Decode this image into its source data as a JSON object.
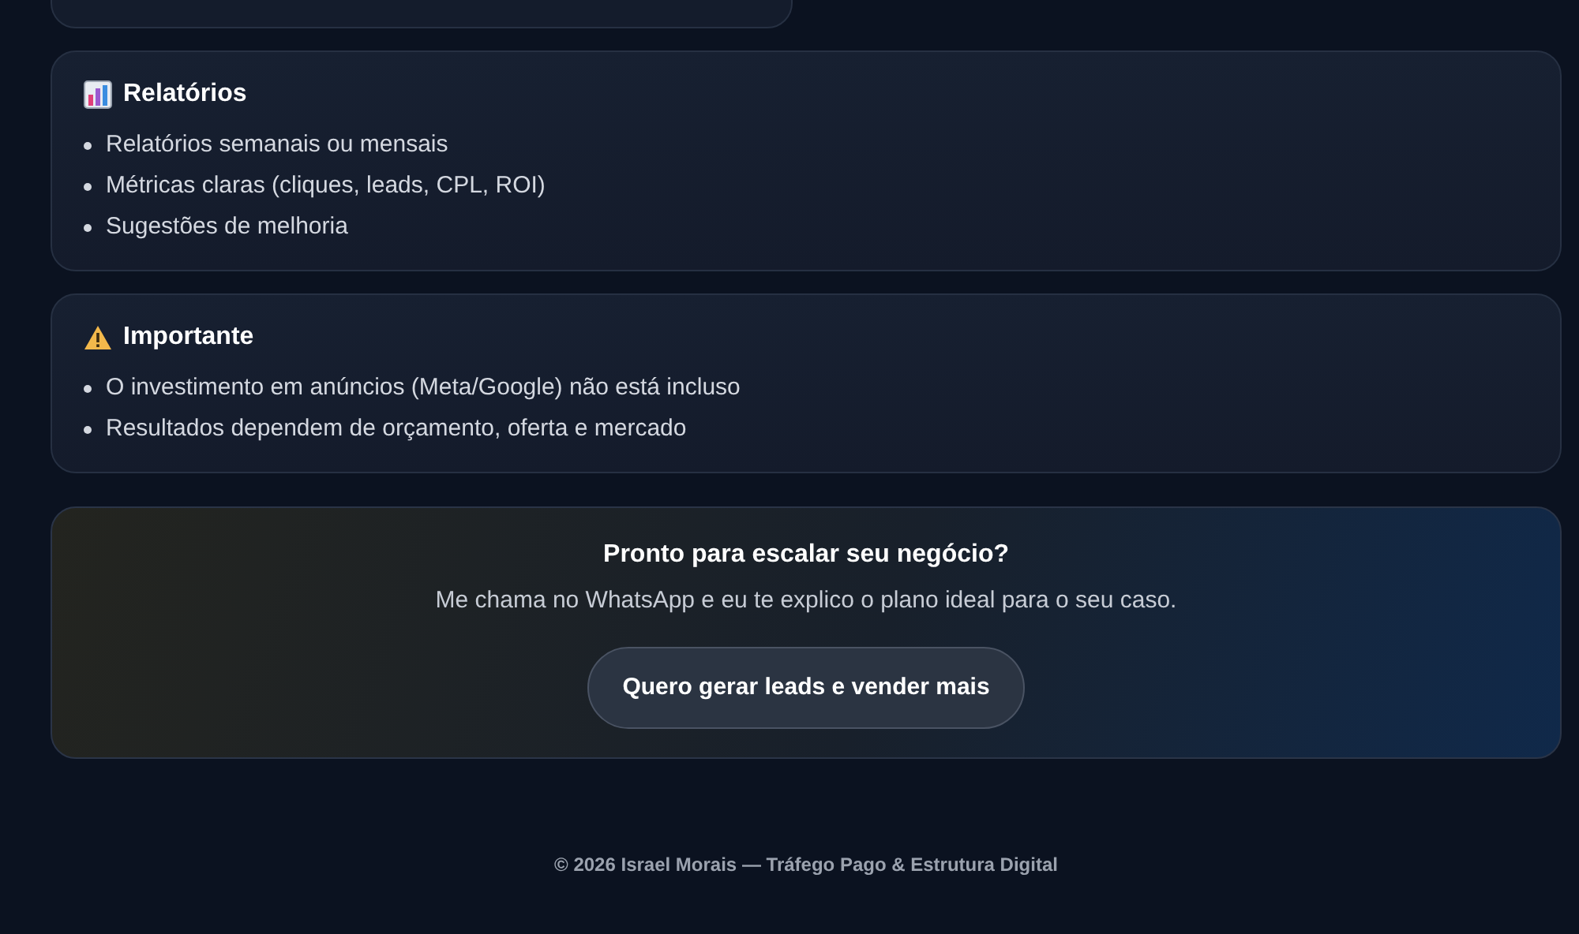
{
  "sections": [
    {
      "kind": "report",
      "title": "Relatórios",
      "items": [
        "Relatórios semanais ou mensais",
        "Métricas claras (cliques, leads, CPL, ROI)",
        "Sugestões de melhoria"
      ]
    },
    {
      "kind": "notice",
      "title": "Importante",
      "items": [
        "O investimento em anúncios (Meta/Google) não está incluso",
        "Resultados dependem de orçamento, oferta e mercado"
      ]
    }
  ],
  "cta": {
    "title": "Pronto para escalar seu negócio?",
    "text": "Me chama no WhatsApp e eu te explico o plano ideal para o seu caso.",
    "button": "Quero gerar leads e vender mais"
  },
  "footer": "© 2026 Israel Morais — Tráfego Pago & Estrutura Digital"
}
